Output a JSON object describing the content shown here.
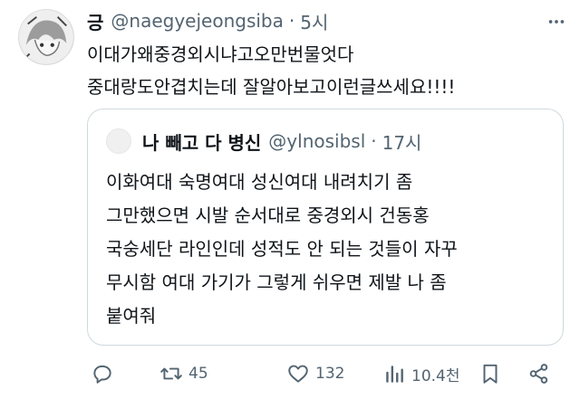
{
  "tweet": {
    "author_name": "긍",
    "handle": "@naegyejeongsiba",
    "separator": "·",
    "time": "5시",
    "text_lines": [
      "이대가왜중경외시냐고오만번물엇다",
      "중대랑도안겹치는데 잘알아보고이런글쓰세요!!!!"
    ]
  },
  "quoted_tweet": {
    "author_name": "나 빼고 다 병신",
    "handle": "@ylnosibsl",
    "separator": "·",
    "time": "17시",
    "text_lines": [
      "이화여대 숙명여대 성신여대 내려치기 좀",
      "그만했으면 시발 순서대로 중경외시 건동홍",
      "국숭세단 라인인데 성적도 안 되는 것들이 자꾸",
      "무시함 여대 가기가 그렇게 쉬우면 제발 나 좀",
      "붙여줘"
    ]
  },
  "actions": {
    "reply_icon": "reply-icon",
    "retweet_icon": "retweet-icon",
    "retweet_count": "45",
    "like_icon": "heart-icon",
    "like_count": "132",
    "views_icon": "views-chart-icon",
    "views_count": "10.4천",
    "bookmark_icon": "bookmark-icon",
    "share_icon": "share-icon"
  },
  "colors": {
    "text": "#0f1419",
    "secondary": "#536471",
    "border": "#cfd9de"
  }
}
